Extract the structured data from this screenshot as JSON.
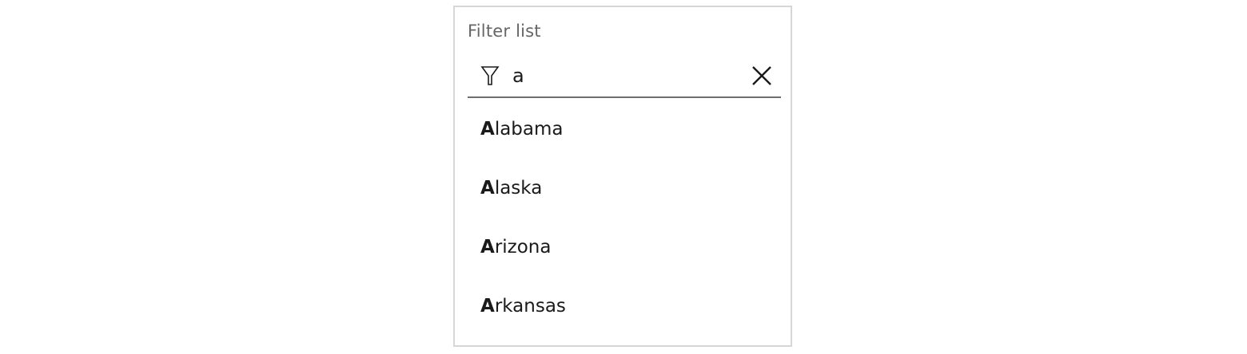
{
  "filter": {
    "label": "Filter list",
    "query": "a",
    "filter_icon": "filter-funnel-icon",
    "clear_icon": "close-x-icon"
  },
  "results": [
    {
      "match": "A",
      "rest": "labama"
    },
    {
      "match": "A",
      "rest": "laska"
    },
    {
      "match": "A",
      "rest": "rizona"
    },
    {
      "match": "A",
      "rest": "rkansas"
    }
  ],
  "colors": {
    "border": "#d6d6d6",
    "underline": "#6e6e6e",
    "label": "#666666",
    "text": "#1a1a1a"
  }
}
